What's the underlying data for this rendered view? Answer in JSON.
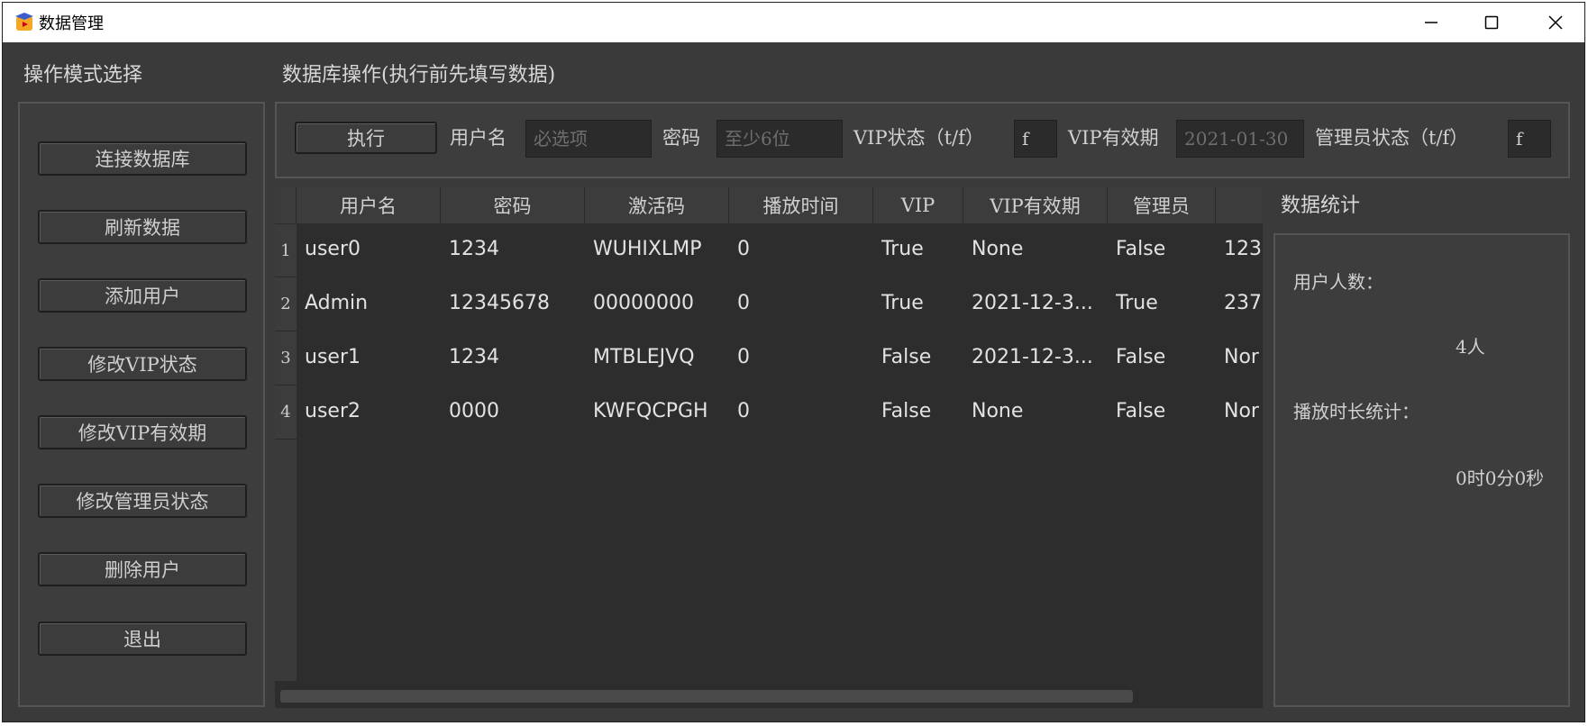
{
  "window": {
    "title": "数据管理",
    "minimize_icon": "minimize-icon",
    "maximize_icon": "maximize-icon",
    "close_icon": "close-icon"
  },
  "mode_panel": {
    "title": "操作模式选择",
    "buttons": [
      "连接数据库",
      "刷新数据",
      "添加用户",
      "修改VIP状态",
      "修改VIP有效期",
      "修改管理员状态",
      "删除用户",
      "退出"
    ]
  },
  "db_ops": {
    "title": "数据库操作(执行前先填写数据)",
    "execute_label": "执行",
    "username_label": "用户名",
    "username_placeholder": "必选项",
    "password_label": "密码",
    "password_placeholder": "至少6位",
    "vip_label": "VIP状态（t/f）",
    "vip_value": "f",
    "vip_expiry_label": "VIP有效期",
    "vip_expiry_placeholder": "2021-01-30",
    "admin_label": "管理员状态（t/f）",
    "admin_value": "f"
  },
  "table": {
    "columns": [
      "用户名",
      "密码",
      "激活码",
      "播放时间",
      "VIP",
      "VIP有效期",
      "管理员"
    ],
    "row_numbers": [
      "1",
      "2",
      "3",
      "4"
    ],
    "rows": [
      [
        "user0",
        "1234",
        "WUHIXLMP",
        "0",
        "True",
        "None",
        "False",
        "123"
      ],
      [
        "Admin",
        "12345678",
        "00000000",
        "0",
        "True",
        "2021-12-3...",
        "True",
        "237"
      ],
      [
        "user1",
        "1234",
        "MTBLEJVQ",
        "0",
        "False",
        "2021-12-3...",
        "False",
        "Nor"
      ],
      [
        "user2",
        "0000",
        "KWFQCPGH",
        "0",
        "False",
        "None",
        "False",
        "Nor"
      ]
    ]
  },
  "stats": {
    "title": "数据统计",
    "user_count_label": "用户人数：",
    "user_count_value": "4人",
    "play_time_label": "播放时长统计：",
    "play_time_value": "0时0分0秒"
  }
}
